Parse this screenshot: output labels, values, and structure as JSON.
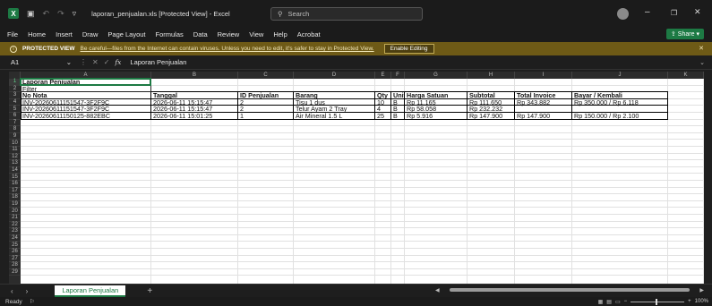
{
  "window": {
    "title": "laporan_penjualan.xls [Protected View] - Excel",
    "search_placeholder": "Search",
    "minimize": "–",
    "restore": "❐",
    "close": "✕"
  },
  "menu": {
    "items": [
      "File",
      "Home",
      "Insert",
      "Draw",
      "Page Layout",
      "Formulas",
      "Data",
      "Review",
      "View",
      "Help",
      "Acrobat"
    ],
    "share_label": "Share"
  },
  "protected_view": {
    "title": "PROTECTED VIEW",
    "message": "Be careful—files from the Internet can contain viruses. Unless you need to edit, it's safer to stay in Protected View.",
    "enable_label": "Enable Editing"
  },
  "formula_bar": {
    "cell_ref": "A1",
    "fx_label": "fx",
    "value": "Laporan Penjualan"
  },
  "columns": [
    "A",
    "B",
    "C",
    "D",
    "E",
    "F",
    "G",
    "H",
    "I",
    "J",
    "K"
  ],
  "rows": [
    "1",
    "2",
    "3",
    "4",
    "5",
    "6",
    "7",
    "8",
    "9",
    "10",
    "11",
    "12",
    "13",
    "14",
    "15",
    "16",
    "17",
    "18",
    "19",
    "20",
    "21",
    "22",
    "23",
    "24",
    "25",
    "26",
    "27",
    "28",
    "29"
  ],
  "sheet": {
    "title": "Laporan Penjualan",
    "filter": "Filter",
    "headers": [
      "No Nota",
      "Tanggal",
      "ID Penjualan",
      "Barang",
      "Qty",
      "Unit",
      "Harga Satuan",
      "Subtotal",
      "Total Invoice",
      "Bayar / Kembali"
    ],
    "data": [
      [
        "INV-20260611151547-3F2F9C",
        "2026-06-11 15:15:47",
        "2",
        "Tisu 1 dus",
        "10",
        "B",
        "Rp 11.165",
        "Rp 111.650",
        "Rp 343.882",
        "Rp 350.000 / Rp 6.118"
      ],
      [
        "INV-20260611151547-3F2F9C",
        "2026-06-11 15:15:47",
        "2",
        "Telur Ayam 2 Tray",
        "4",
        "B",
        "Rp 58.058",
        "Rp 232.232",
        "",
        ""
      ],
      [
        "INV-20260611150125-882EBC",
        "2026-06-11 15:01:25",
        "1",
        "Air Mineral 1.5 L",
        "25",
        "B",
        "Rp 5.916",
        "Rp 147.900",
        "Rp 147.900",
        "Rp 150.000 / Rp 2.100"
      ]
    ]
  },
  "sheet_tabs": {
    "active": "Laporan Penjualan",
    "add": "+"
  },
  "status": {
    "ready": "Ready",
    "zoom": "100%"
  }
}
